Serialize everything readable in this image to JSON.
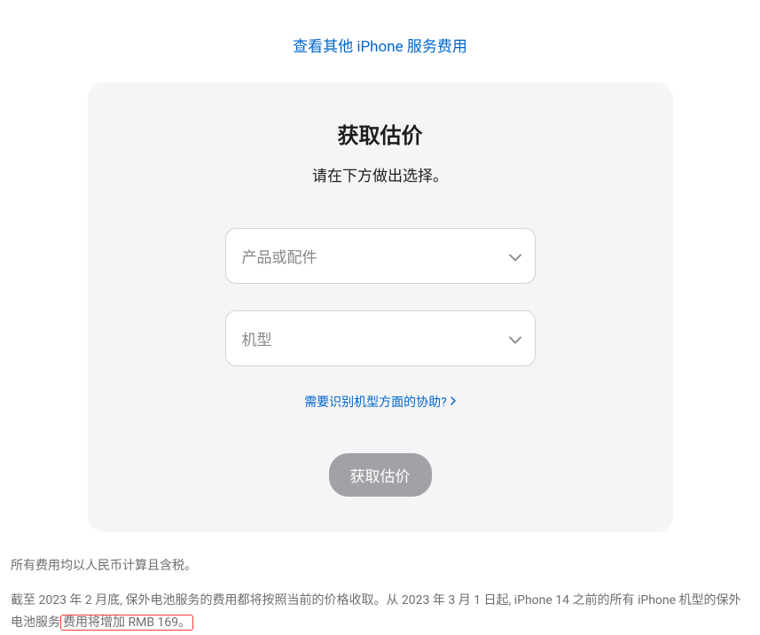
{
  "header": {
    "top_link": "查看其他 iPhone 服务费用"
  },
  "card": {
    "title": "获取估价",
    "subtitle": "请在下方做出选择。",
    "select1_placeholder": "产品或配件",
    "select2_placeholder": "机型",
    "help_link": "需要识别机型方面的协助?",
    "submit_label": "获取估价"
  },
  "footer": {
    "line1": "所有费用均以人民币计算且含税。",
    "line2_pre": "截至 2023 年 2 月底, 保外电池服务的费用都将按照当前的价格收取。从 2023 年 3 月 1 日起, iPhone 14 之前的所有 iPhone 机型的保外电池服务",
    "line2_highlight": "费用将增加 RMB 169。"
  }
}
